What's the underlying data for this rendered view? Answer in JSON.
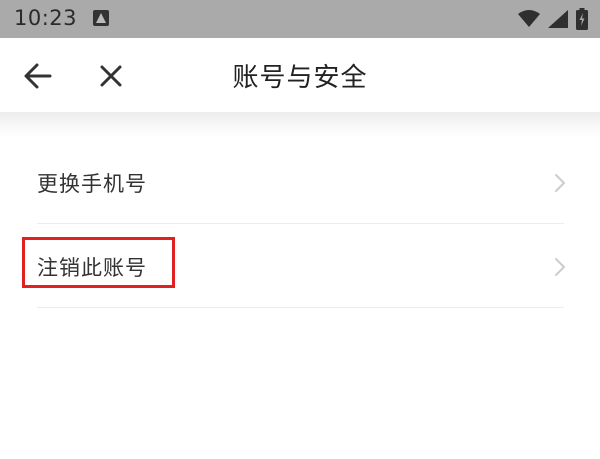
{
  "status_bar": {
    "time": "10:23",
    "icons": [
      "notification-a-icon",
      "wifi-icon",
      "signal-icon",
      "battery-icon"
    ]
  },
  "app_bar": {
    "title": "账号与安全",
    "icons": [
      "back-arrow-icon",
      "close-icon"
    ]
  },
  "list": {
    "items": [
      {
        "label": "更换手机号"
      },
      {
        "label": "注销此账号"
      }
    ]
  },
  "colors": {
    "status_bar_bg": "#aaaaaa",
    "highlight": "#e0211f",
    "text": "#333333",
    "divider": "#ececec"
  }
}
